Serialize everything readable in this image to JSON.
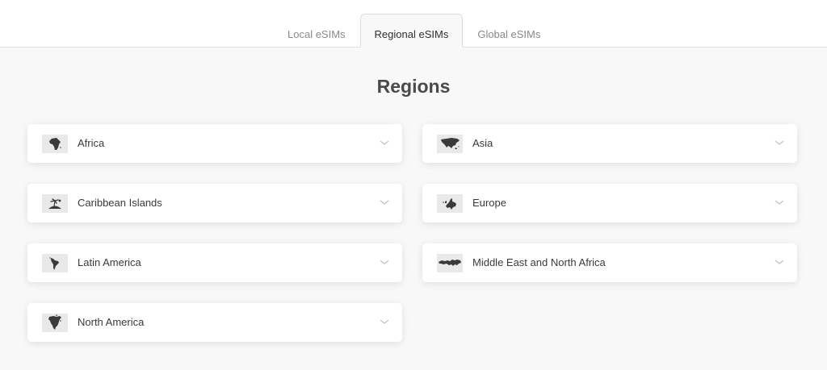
{
  "tabs": [
    {
      "label": "Local eSIMs",
      "active": false
    },
    {
      "label": "Regional eSIMs",
      "active": true
    },
    {
      "label": "Global eSIMs",
      "active": false
    }
  ],
  "page_title": "Regions",
  "regions": [
    {
      "label": "Africa",
      "icon": "africa-map-icon"
    },
    {
      "label": "Asia",
      "icon": "asia-map-icon"
    },
    {
      "label": "Caribbean Islands",
      "icon": "caribbean-islands-icon"
    },
    {
      "label": "Europe",
      "icon": "europe-map-icon"
    },
    {
      "label": "Latin America",
      "icon": "latin-america-map-icon"
    },
    {
      "label": "Middle East and North Africa",
      "icon": "middle-east-north-africa-map-icon"
    },
    {
      "label": "North America",
      "icon": "north-america-map-icon"
    }
  ],
  "colors": {
    "page_background": "#f8f8f8",
    "card_background": "#ffffff",
    "map_silhouette": "#3a3a3a",
    "map_background": "#e9e9e9",
    "muted_text": "#8a8a8a"
  }
}
